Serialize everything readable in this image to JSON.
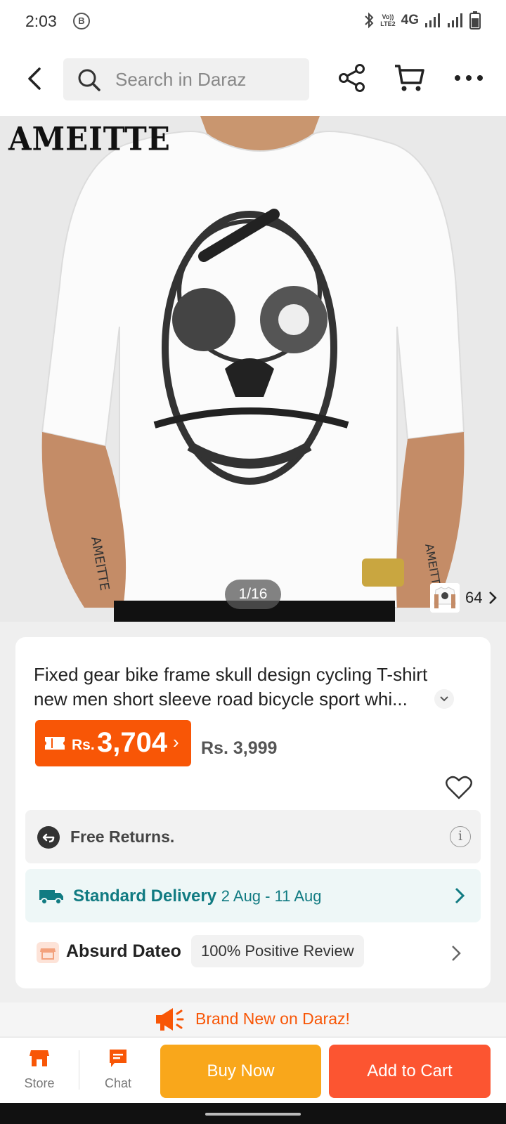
{
  "status_bar": {
    "time": "2:03",
    "badge": "B",
    "volte_top": "Vo))",
    "volte_bottom": "LTE2",
    "network": "4G"
  },
  "header": {
    "search_placeholder": "Search in Daraz",
    "icons": [
      "back-arrow-icon",
      "search-icon",
      "share-icon",
      "cart-icon",
      "more-icon"
    ]
  },
  "gallery": {
    "brand_logo": "AMEITTE",
    "position": "1/16",
    "thumbnail_count": "64"
  },
  "product": {
    "title": "Fixed gear bike frame skull design cycling T-shirt new men short sleeve road bicycle sport whi...",
    "currency": "Rs.",
    "price": "3,704",
    "original_price": "Rs. 3,999"
  },
  "returns": {
    "label": "Free Returns."
  },
  "delivery": {
    "label": "Standard Delivery",
    "dates": "2 Aug - 11 Aug"
  },
  "seller": {
    "name": "Absurd Dateo",
    "badge": "100% Positive Review"
  },
  "promo": {
    "text": "Brand New on Daraz!"
  },
  "bottom_bar": {
    "store_label": "Store",
    "chat_label": "Chat",
    "buy_now_label": "Buy Now",
    "add_to_cart_label": "Add to Cart"
  },
  "colors": {
    "brand_orange": "#f85606",
    "buy_now": "#f9a71b",
    "add_to_cart": "#fc5531",
    "delivery_teal": "#117b82"
  }
}
